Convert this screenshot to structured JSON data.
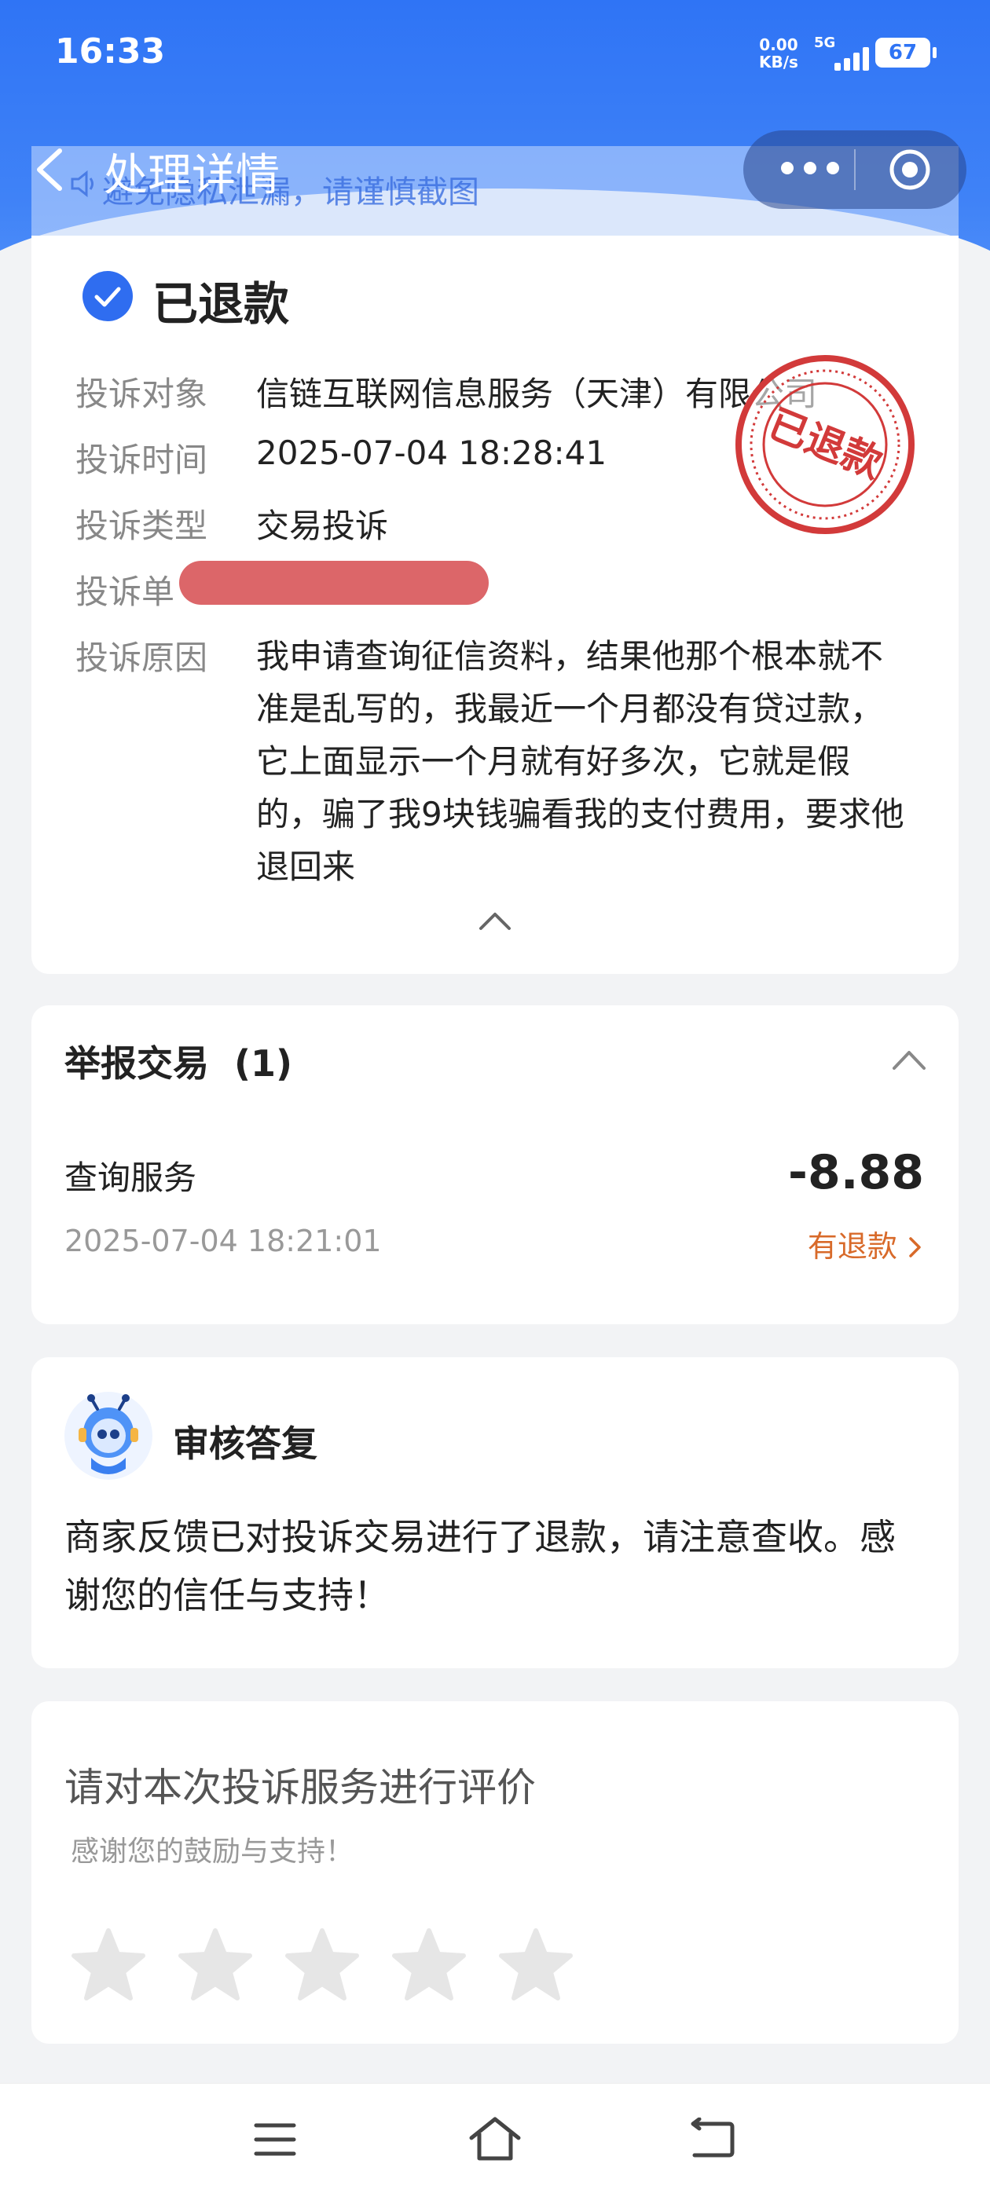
{
  "status_bar": {
    "time": "16:33",
    "net_speed_value": "0.00",
    "net_speed_unit": "KB/s",
    "network": "5G",
    "battery": "67"
  },
  "privacy_banner": "避免隐私泄漏，请谨慎截图",
  "nav": {
    "title": "处理详情"
  },
  "complaint": {
    "status": "已退款",
    "stamp_text": "已退款",
    "fields": [
      {
        "label": "投诉对象",
        "value": "信链互联网信息服务（天津）有限公司"
      },
      {
        "label": "投诉时间",
        "value": "2025-07-04 18:28:41"
      },
      {
        "label": "投诉类型",
        "value": "交易投诉"
      },
      {
        "label": "投诉单",
        "value": ""
      },
      {
        "label": "投诉原因",
        "value": "我申请查询征信资料，结果他那个根本就不准是乱写的，我最近一个月都没有贷过款，它上面显示一个月就有好多次，它就是假的，骗了我9块钱骗看我的支付费用，要求他退回来"
      }
    ]
  },
  "transactions": {
    "title": "举报交易",
    "count": "(1)",
    "item": {
      "name": "查询服务",
      "time": "2025-07-04 18:21:01",
      "amount": "-8.88",
      "refund_status": "有退款"
    }
  },
  "review": {
    "title": "审核答复",
    "text": "商家反馈已对投诉交易进行了退款，请注意查收。感谢您的信任与支持！"
  },
  "rating": {
    "title": "请对本次投诉服务进行评价",
    "subtitle": "感谢您的鼓励与支持！",
    "stars_total": 5,
    "stars_selected": 0
  }
}
